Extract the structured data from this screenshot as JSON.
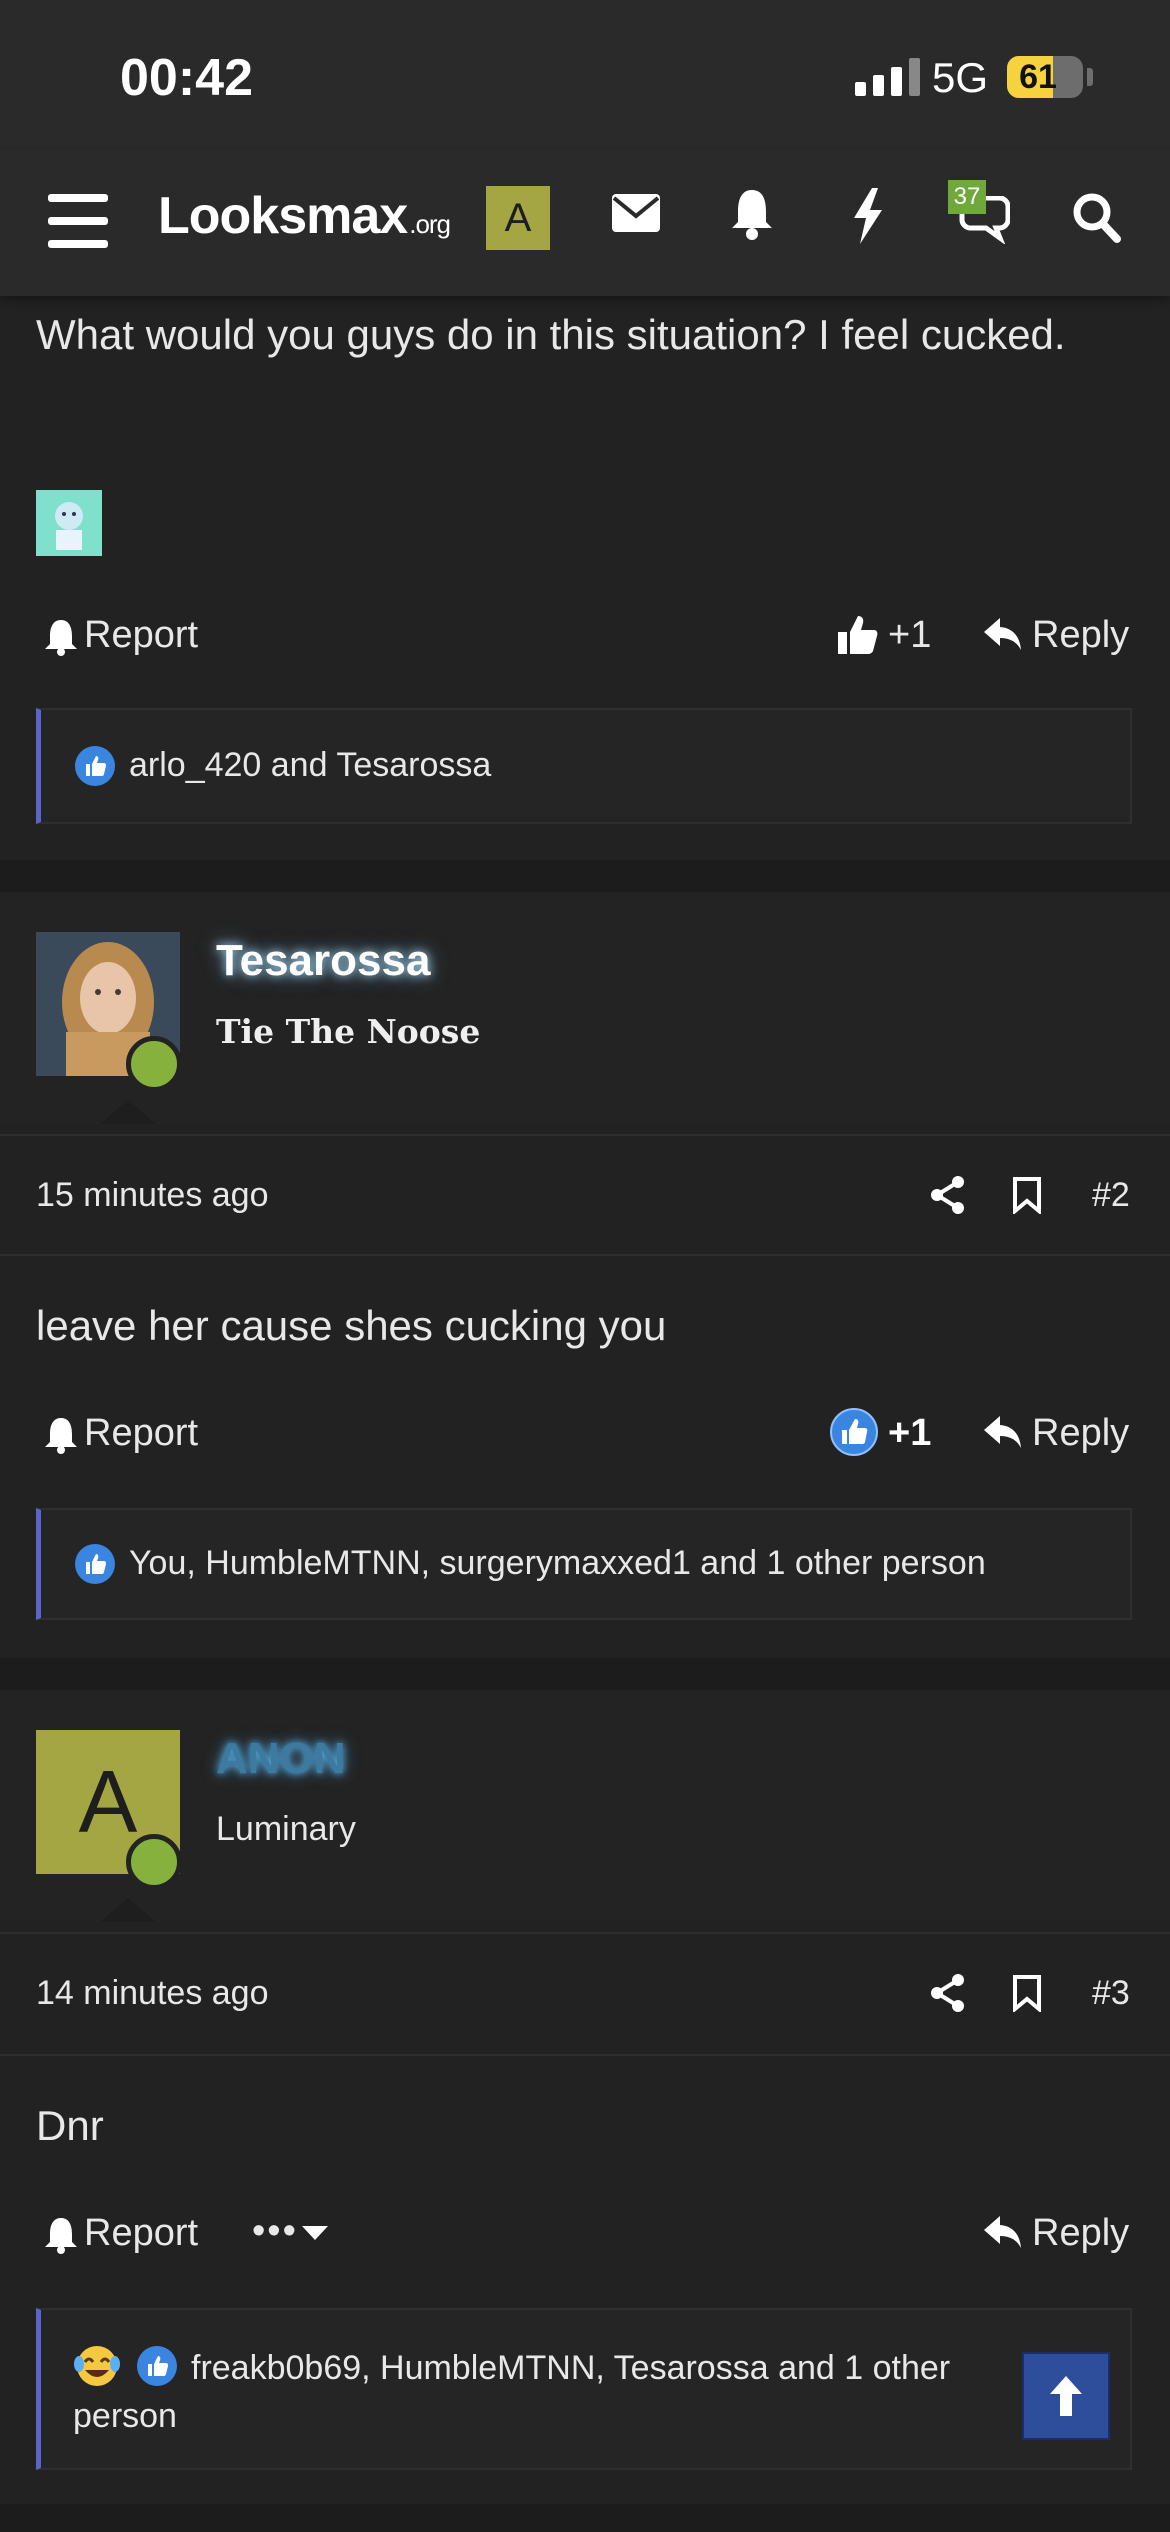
{
  "status_bar": {
    "time": "00:42",
    "network": "5G",
    "battery": "61",
    "battery_level": 0.61
  },
  "nav": {
    "logo_main": "Looksmax",
    "logo_suffix": ".org",
    "account_letter": "A",
    "conversations_badge": "37"
  },
  "first_post": {
    "text": "What would you guys do in this situation? I feel cucked.",
    "report_label": "Report",
    "like_label": "+1",
    "reply_label": "Reply",
    "likes_text": "arlo_420 and Tesarossa"
  },
  "posts": [
    {
      "username": "Tesarossa",
      "user_title": "Tie The Noose",
      "time": "15 minutes ago",
      "number": "#2",
      "text": "leave her cause shes cucking you",
      "report_label": "Report",
      "like_label": "+1",
      "reply_label": "Reply",
      "likes_text": "You, HumbleMTNN, surgerymaxxed1 and 1 other person"
    },
    {
      "username": "ANON",
      "avatar_letter": "A",
      "user_title": "Luminary",
      "time": "14 minutes ago",
      "number": "#3",
      "text": "Dnr",
      "report_label": "Report",
      "more_label": "•••",
      "reply_label": "Reply",
      "likes_text": "freakb0b69, HumbleMTNN, Tesarossa and 1 other person"
    }
  ]
}
